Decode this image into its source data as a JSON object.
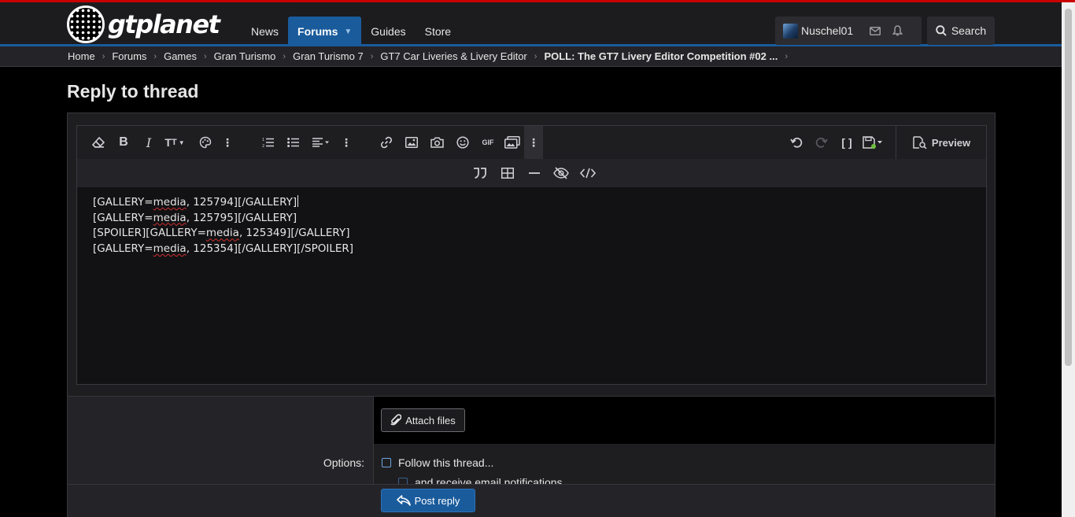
{
  "brand": {
    "logo_text": "gtplanet",
    "accent": "#1a5b9c",
    "topline": "#c90000"
  },
  "nav": {
    "items": [
      {
        "label": "News",
        "active": false
      },
      {
        "label": "Forums",
        "active": true
      },
      {
        "label": "Guides",
        "active": false
      },
      {
        "label": "Store",
        "active": false
      }
    ]
  },
  "user": {
    "name": "Nuschel01",
    "icons": [
      "mail-icon",
      "bell-icon"
    ]
  },
  "search": {
    "label": "Search"
  },
  "breadcrumbs": [
    "Home",
    "Forums",
    "Games",
    "Gran Turismo",
    "Gran Turismo 7",
    "GT7 Car Liveries & Livery Editor",
    "POLL: The GT7 Livery Editor Competition #02 ..."
  ],
  "page": {
    "title": "Reply to thread"
  },
  "editor": {
    "toolbar_icons": [
      "eraser-icon",
      "bold-icon",
      "italic-icon",
      "font-size-icon",
      "palette-icon",
      "more-icon",
      "ordered-list-icon",
      "unordered-list-icon",
      "align-icon",
      "more-icon",
      "link-icon",
      "image-icon",
      "camera-icon",
      "smiley-icon",
      "gif-icon",
      "media-icon",
      "more-icon",
      "undo-icon",
      "redo-icon",
      "bbcode-icon",
      "drafts-icon"
    ],
    "toolbar2_icons": [
      "quote-icon",
      "table-icon",
      "horizontal-rule-icon",
      "spoiler-icon",
      "code-icon"
    ],
    "preview_label": "Preview",
    "lines": [
      {
        "pre": "[GALLERY=",
        "word": "media",
        "post": ", 125794][/GALLERY]"
      },
      {
        "pre": "[GALLERY=",
        "word": "media",
        "post": ", 125795][/GALLERY]"
      },
      {
        "pre": "[SPOILER][GALLERY=",
        "word": "media",
        "post": ", 125349][/GALLERY]"
      },
      {
        "pre": "[GALLERY=",
        "word": "media",
        "post": ", 125354][/GALLERY][/SPOILER]"
      }
    ]
  },
  "attach": {
    "label": "Attach files"
  },
  "options": {
    "label": "Options:",
    "follow_label": "Follow this thread...",
    "email_label": "and receive email notifications"
  },
  "submit": {
    "label": "Post reply"
  }
}
